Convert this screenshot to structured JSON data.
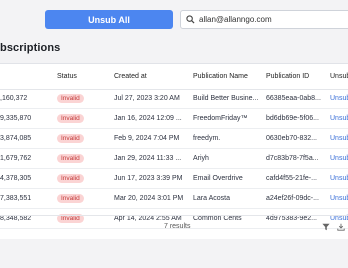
{
  "toolbar": {
    "unsub_all_label": "Unsub All",
    "search_value": "allan@allanngo.com",
    "search_icon": "search-icon"
  },
  "page": {
    "title": "bscriptions"
  },
  "table": {
    "columns": [
      "",
      "Status",
      "Created at",
      "Publication Name",
      "Publication ID",
      "Unsub"
    ],
    "rows": [
      {
        "num": ",160,372",
        "status": "Invalid",
        "created": "Jul 27, 2023 3:20 AM",
        "pub_name": "Build Better Busine...",
        "pub_id": "66385eaa-0ab8...",
        "unsub": "Unsub"
      },
      {
        "num": "9,335,870",
        "status": "Invalid",
        "created": "Jan 16, 2024 12:09 ...",
        "pub_name": "FreedomFriday™",
        "pub_id": "bd6db69e-5f06...",
        "unsub": "Unsub"
      },
      {
        "num": "3,874,085",
        "status": "Invalid",
        "created": "Feb 9, 2024 7:04 PM",
        "pub_name": "freedym.",
        "pub_id": "0630eb70-832...",
        "unsub": "Unsub"
      },
      {
        "num": "1,679,762",
        "status": "Invalid",
        "created": "Jan 29, 2024 11:33 ...",
        "pub_name": "Ariyh",
        "pub_id": "d7c83b78-7f5a...",
        "unsub": "Unsub"
      },
      {
        "num": "4,378,305",
        "status": "Invalid",
        "created": "Jun 17, 2023 3:39 PM",
        "pub_name": "Email Overdrive",
        "pub_id": "cafd4f55-21fe-...",
        "unsub": "Unsub"
      },
      {
        "num": "7,383,551",
        "status": "Invalid",
        "created": "Mar 20, 2024 3:01 PM",
        "pub_name": "Lara Acosta",
        "pub_id": "a24ef26f-09dc-...",
        "unsub": "Unsub"
      },
      {
        "num": "8,348,582",
        "status": "Invalid",
        "created": "Apr 14, 2024 2:55 AM",
        "pub_name": "Common Cents",
        "pub_id": "4d975383-9e2...",
        "unsub": "Unsub"
      }
    ]
  },
  "footer": {
    "count_label": "7 results",
    "filter_icon": "filter-icon",
    "download_icon": "download-icon"
  },
  "colors": {
    "accent": "#4c86f0",
    "badge_bg": "#fbd4d4",
    "badge_text": "#c23b3b",
    "link": "#3a6fd8"
  }
}
